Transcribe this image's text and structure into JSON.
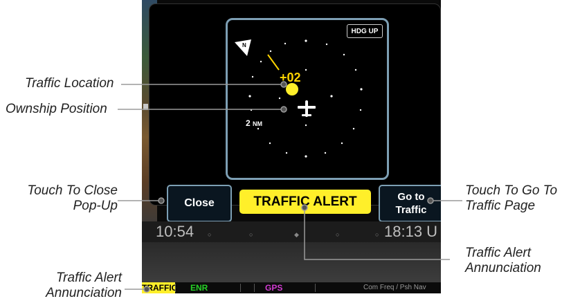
{
  "radar": {
    "hdg_mode": "HDG UP",
    "traffic_altitude": "+02",
    "range": "2",
    "range_unit": "NM"
  },
  "buttons": {
    "close": "Close",
    "goto_line1": "Go to",
    "goto_line2": "Traffic"
  },
  "alert_annunciation": "TRAFFIC ALERT",
  "timebar": {
    "left_time": "10:54",
    "right_time": "18:13 U"
  },
  "statusbar": {
    "traffic": "TRAFFIC",
    "enr": "ENR",
    "gps": "GPS",
    "com": "Com Freq / Psh Nav"
  },
  "callouts": {
    "traffic_location": "Traffic Location",
    "ownship_position": "Ownship Position",
    "touch_close_1": "Touch To Close",
    "touch_close_2": "Pop-Up",
    "touch_goto_1": "Touch To Go To",
    "touch_goto_2": "Traffic Page",
    "alert_ann_right_1": "Traffic Alert",
    "alert_ann_right_2": "Annunciation",
    "alert_ann_left_1": "Traffic Alert",
    "alert_ann_left_2": "Annunciation"
  },
  "colors": {
    "traffic_yellow": "#ffef2a",
    "frame_blue": "#7d9fb4",
    "enr_green": "#27d227",
    "gps_magenta": "#d23cd2"
  },
  "icons": [
    "north-arrow-icon",
    "traffic-target-icon",
    "ownship-aircraft-icon"
  ]
}
